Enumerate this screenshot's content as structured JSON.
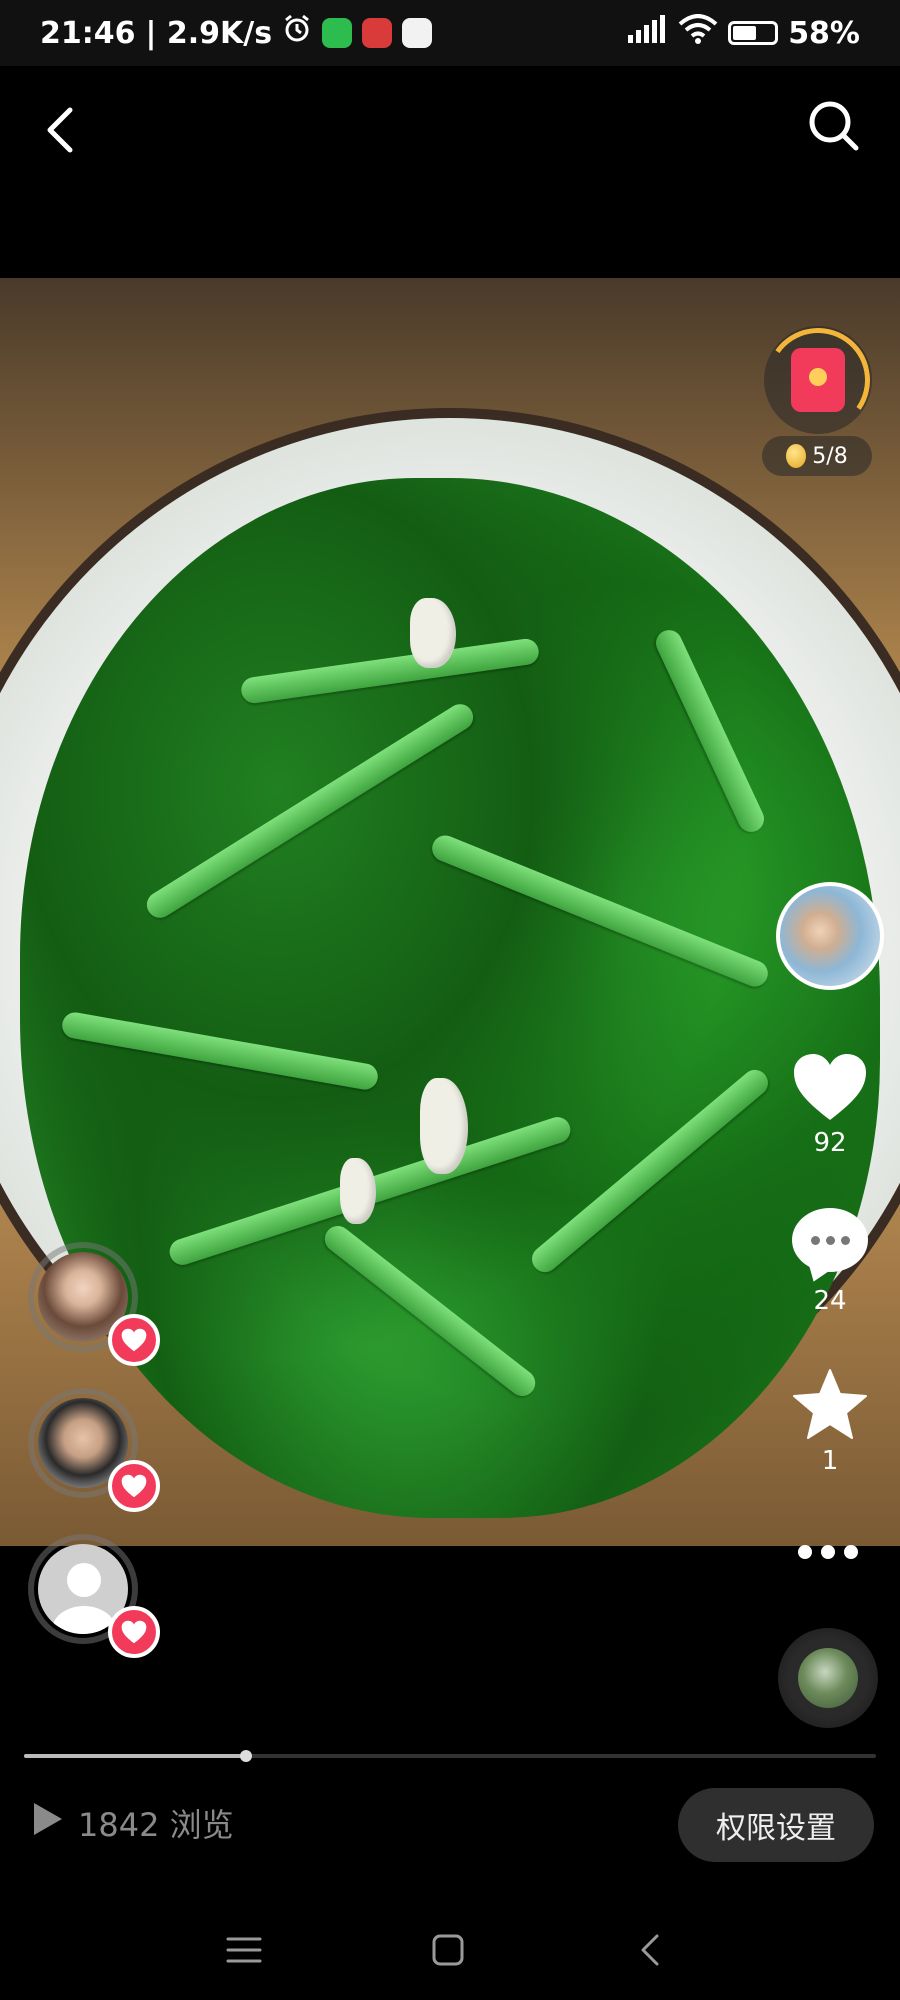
{
  "status_bar": {
    "time": "21:46",
    "speed": "| 2.9K/s",
    "battery": "58%",
    "battery_level": 0.58,
    "notification_icons": [
      "alarm-icon",
      "wechat-icon",
      "app-red-icon",
      "app-calendar-icon"
    ]
  },
  "top_nav": {
    "back_icon": "chevron-left-icon",
    "search_icon": "search-icon"
  },
  "rewards": {
    "coin_progress": "5/8"
  },
  "actions": {
    "likes": "92",
    "comments": "24",
    "favorites": "1"
  },
  "playback": {
    "progress": 0.26
  },
  "footer": {
    "views": "1842 浏览",
    "permission_button": "权限设置"
  },
  "colors": {
    "accent_red": "#f23a5a",
    "gold": "#f3b53a",
    "background": "#000000"
  }
}
